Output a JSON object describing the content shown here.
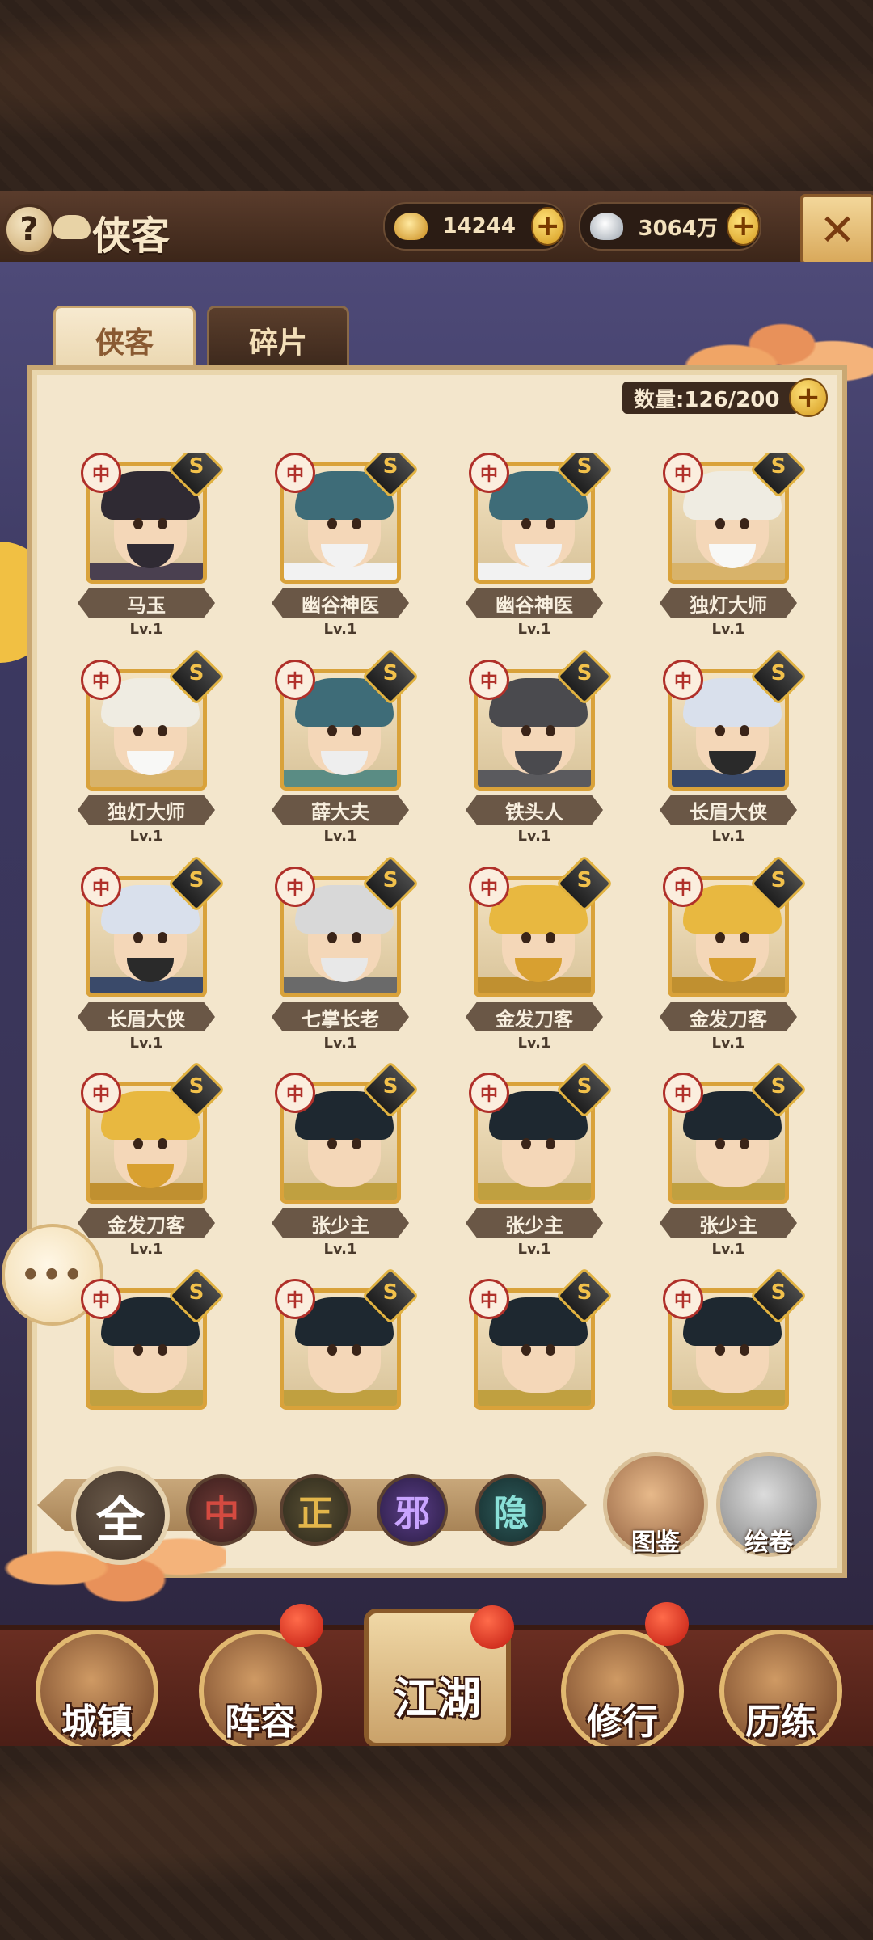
{
  "header": {
    "help_label": "?",
    "title": "侠客",
    "gold": {
      "icon": "gold-ingot-icon",
      "value": "14244",
      "add_label": "+"
    },
    "silver": {
      "icon": "silver-ingot-icon",
      "value": "3064万",
      "add_label": "+"
    },
    "close_icon": "crossed-swords-icon"
  },
  "tabs": [
    {
      "label": "侠客",
      "active": true
    },
    {
      "label": "碎片",
      "active": false
    }
  ],
  "capacity": {
    "label": "数量:126/200",
    "current": 126,
    "max": 200,
    "add_label": "+"
  },
  "heroes": [
    {
      "name": "马玉",
      "level": "Lv.1",
      "faction": "中",
      "rank": "S"
    },
    {
      "name": "幽谷神医",
      "level": "Lv.1",
      "faction": "中",
      "rank": "S"
    },
    {
      "name": "幽谷神医",
      "level": "Lv.1",
      "faction": "中",
      "rank": "S"
    },
    {
      "name": "独灯大师",
      "level": "Lv.1",
      "faction": "中",
      "rank": "S"
    },
    {
      "name": "独灯大师",
      "level": "Lv.1",
      "faction": "中",
      "rank": "S"
    },
    {
      "name": "薛大夫",
      "level": "Lv.1",
      "faction": "中",
      "rank": "S"
    },
    {
      "name": "铁头人",
      "level": "Lv.1",
      "faction": "中",
      "rank": "S"
    },
    {
      "name": "长眉大侠",
      "level": "Lv.1",
      "faction": "中",
      "rank": "S"
    },
    {
      "name": "长眉大侠",
      "level": "Lv.1",
      "faction": "中",
      "rank": "S"
    },
    {
      "name": "七掌长老",
      "level": "Lv.1",
      "faction": "中",
      "rank": "S"
    },
    {
      "name": "金发刀客",
      "level": "Lv.1",
      "faction": "中",
      "rank": "S"
    },
    {
      "name": "金发刀客",
      "level": "Lv.1",
      "faction": "中",
      "rank": "S"
    },
    {
      "name": "金发刀客",
      "level": "Lv.1",
      "faction": "中",
      "rank": "S"
    },
    {
      "name": "张少主",
      "level": "Lv.1",
      "faction": "中",
      "rank": "S"
    },
    {
      "name": "张少主",
      "level": "Lv.1",
      "faction": "中",
      "rank": "S"
    },
    {
      "name": "张少主",
      "level": "Lv.1",
      "faction": "中",
      "rank": "S"
    },
    {
      "name": "",
      "level": "",
      "faction": "中",
      "rank": "S"
    },
    {
      "name": "",
      "level": "",
      "faction": "中",
      "rank": "S"
    },
    {
      "name": "",
      "level": "",
      "faction": "中",
      "rank": "S"
    },
    {
      "name": "",
      "level": "",
      "faction": "中",
      "rank": "S"
    }
  ],
  "filters": [
    {
      "label": "全",
      "selected": true
    },
    {
      "label": "中"
    },
    {
      "label": "正"
    },
    {
      "label": "邪"
    },
    {
      "label": "隐"
    }
  ],
  "side_buttons": {
    "codex": "图鉴",
    "scroll": "绘卷",
    "chat_icon": "chat-bubble-icon"
  },
  "nav": [
    {
      "label": "城镇",
      "badge": false
    },
    {
      "label": "阵容",
      "badge": true
    },
    {
      "label": "江湖",
      "badge": false
    },
    {
      "label": "修行",
      "badge": true
    },
    {
      "label": "历练",
      "badge": false
    }
  ],
  "colors": {
    "accent_gold": "#d9a23a",
    "panel_bg": "#f3e6cc",
    "faction_red": "#b0302a",
    "band_purple": "#3b3860"
  }
}
